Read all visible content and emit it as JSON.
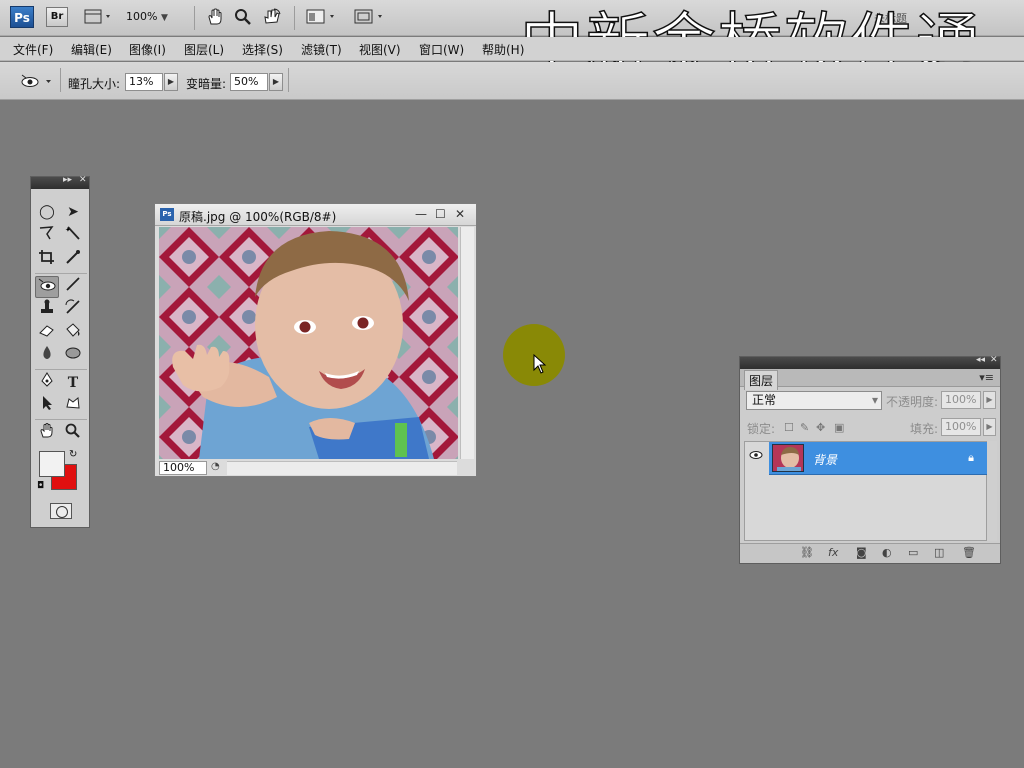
{
  "appbar": {
    "ps_logo": "Ps",
    "br_logo": "Br",
    "zoom": "100%",
    "workspace_label": "未标题",
    "watermark": "中新金桥软件通"
  },
  "menu": {
    "items": [
      "文件(F)",
      "编辑(E)",
      "图像(I)",
      "图层(L)",
      "选择(S)",
      "滤镜(T)",
      "视图(V)",
      "窗口(W)",
      "帮助(H)"
    ]
  },
  "options": {
    "pupil_label": "瞳孔大小:",
    "pupil_value": "13%",
    "darken_label": "变暗量:",
    "darken_value": "50%"
  },
  "document": {
    "title": "原稿.jpg @ 100%(RGB/8#)",
    "zoom_status": "100%"
  },
  "layers_panel": {
    "tab": "图层",
    "blend_mode": "正常",
    "opacity_label": "不透明度:",
    "opacity_value": "100%",
    "lock_label": "锁定:",
    "fill_label": "填充:",
    "fill_value": "100%",
    "layer_name": "背景"
  },
  "colors": {
    "foreground": "#f2f2f2",
    "background": "#e00f0f",
    "selected_layer": "#3e8fe0",
    "cursor_highlight": "#8a8a00"
  }
}
